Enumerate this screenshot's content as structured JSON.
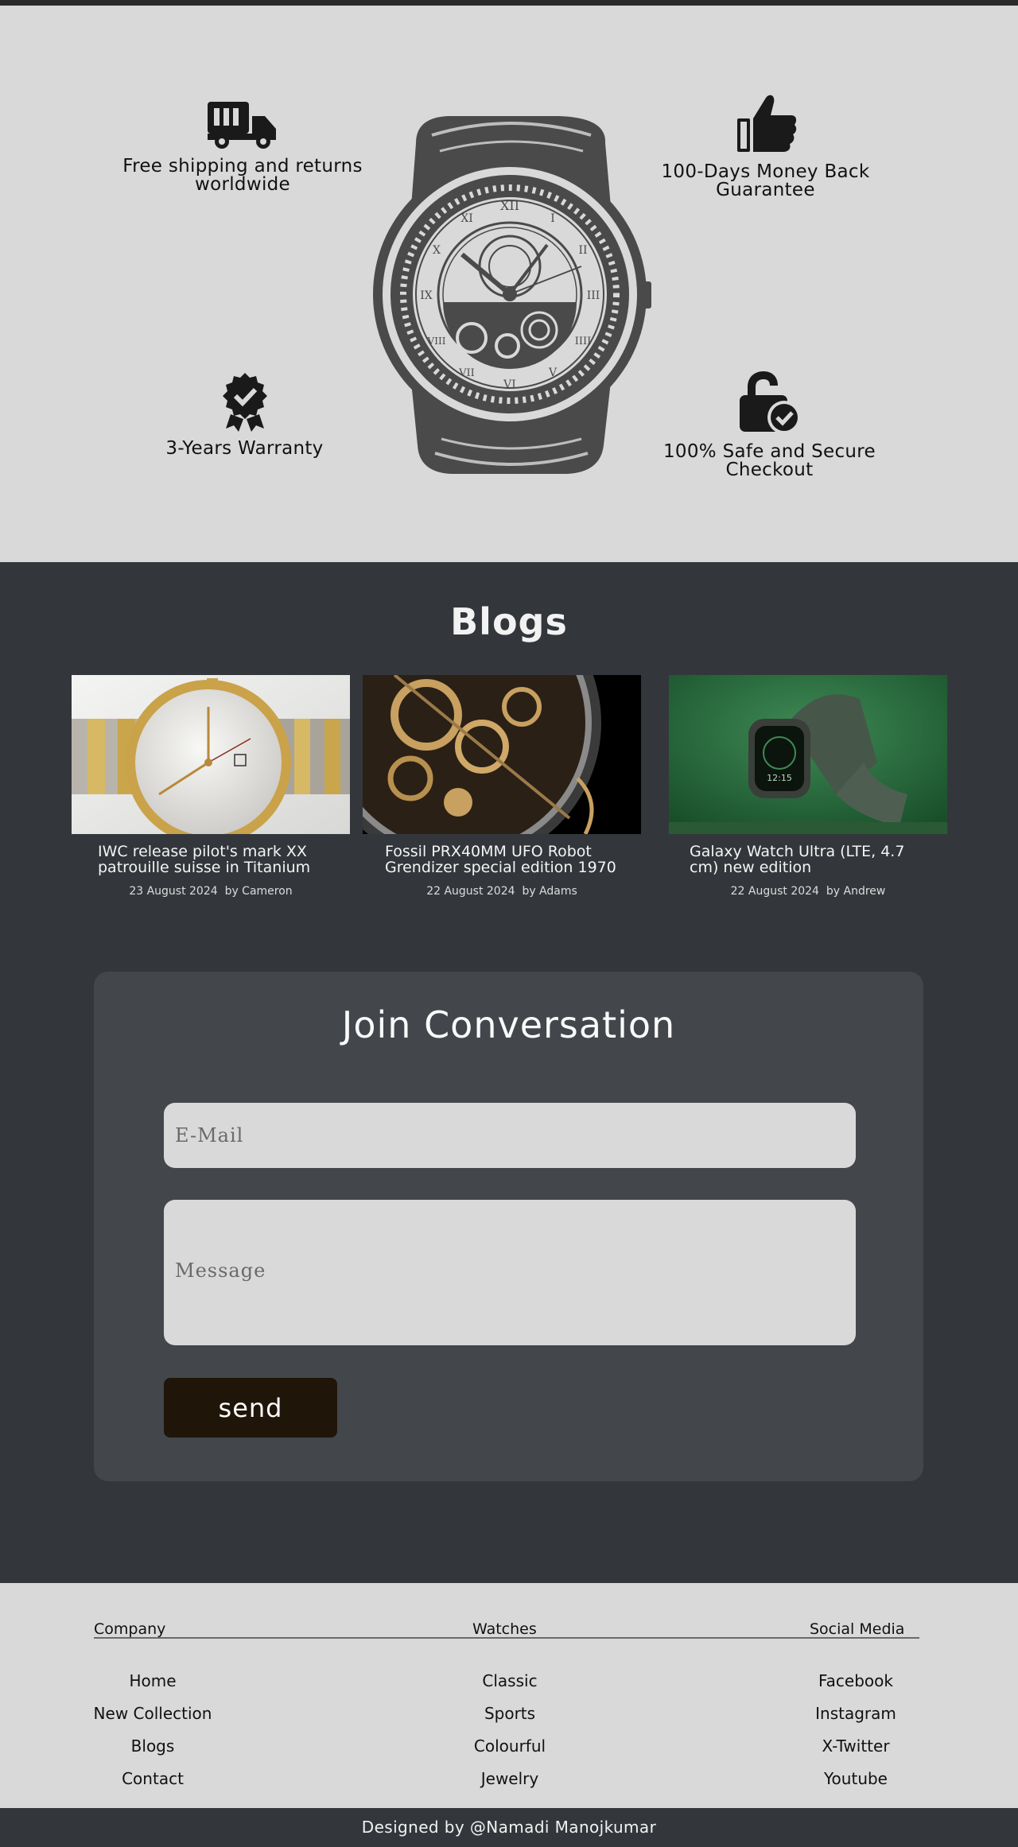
{
  "features": {
    "shipping": "Free shipping and returns worldwide",
    "money_back": "100-Days Money Back Guarantee",
    "warranty": "3-Years Warranty",
    "secure": "100% Safe and Secure Checkout",
    "watch_numerals": [
      "XII",
      "I",
      "II",
      "III",
      "IIII",
      "V",
      "VI",
      "VII",
      "VIII",
      "IX",
      "X",
      "XI"
    ]
  },
  "blogs": {
    "title": "Blogs",
    "posts": [
      {
        "title": "IWC release pilot's mark XX patrouille suisse in Titanium",
        "date": "23 August 2024",
        "author": "by Cameron"
      },
      {
        "title": "Fossil PRX40MM UFO Robot Grendizer special edition 1970",
        "date": "22 August 2024",
        "author": "by Adams"
      },
      {
        "title": "Galaxy Watch Ultra (LTE, 4.7 cm) new edition",
        "date": "22 August 2024",
        "author": "by Andrew"
      }
    ],
    "smartwatch_time": "12:15"
  },
  "contact": {
    "title": "Join Conversation",
    "email_placeholder": "E-Mail",
    "message_placeholder": "Message",
    "send_label": "send"
  },
  "footer": {
    "company": {
      "heading": "Company",
      "links": [
        "Home",
        "New Collection",
        "Blogs",
        "Contact"
      ]
    },
    "watches": {
      "heading": "Watches",
      "links": [
        "Classic",
        "Sports",
        "Colourful",
        "Jewelry"
      ]
    },
    "social": {
      "heading": "Social Media",
      "links": [
        "Facebook",
        "Instagram",
        "X-Twitter",
        "Youtube"
      ]
    },
    "credit": "Designed by @Namadi Manojkumar"
  },
  "colors": {
    "light_bg": "#d9d9d9",
    "dark_bg": "#33373b",
    "card_bg": "#43474c",
    "button": "#201509"
  }
}
